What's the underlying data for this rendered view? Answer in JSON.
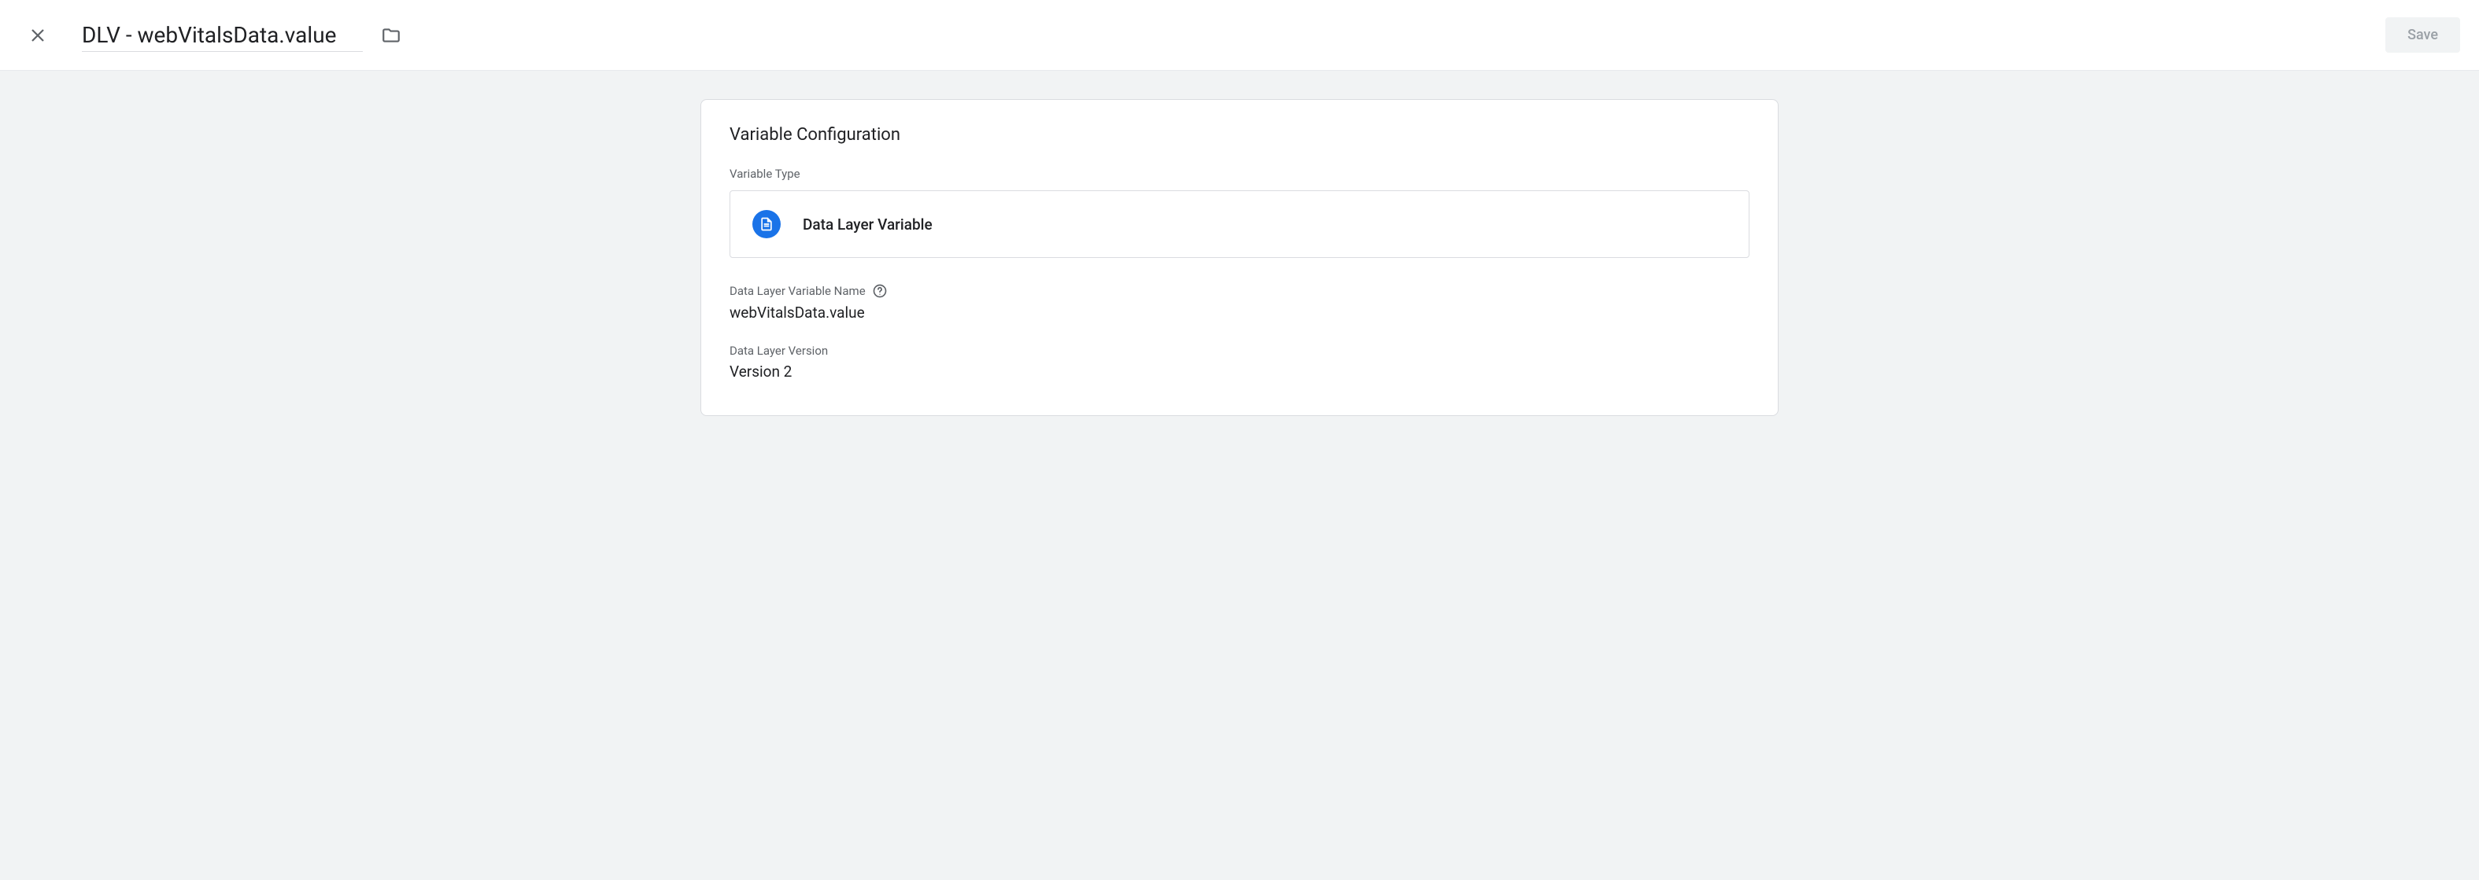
{
  "header": {
    "title": "DLV - webVitalsData.value",
    "save_label": "Save"
  },
  "card": {
    "title": "Variable Configuration",
    "variable_type_label": "Variable Type",
    "variable_type_value": "Data Layer Variable",
    "dlv_name_label": "Data Layer Variable Name",
    "dlv_name_value": "webVitalsData.value",
    "dlv_version_label": "Data Layer Version",
    "dlv_version_value": "Version 2"
  }
}
